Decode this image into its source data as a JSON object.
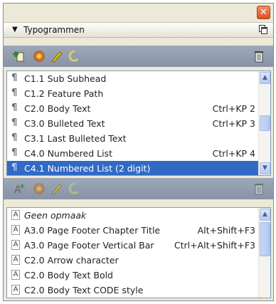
{
  "panel": {
    "title": "Typogrammen",
    "close_glyph": "✕"
  },
  "paragraph_styles": {
    "toolbar_icons": [
      "new-style-icon",
      "load-styles-icon",
      "edit-style-icon",
      "clear-overrides-icon",
      "delete-style-icon"
    ],
    "items": [
      {
        "label": "C1.1 Sub Subhead",
        "shortcut": "",
        "selected": false
      },
      {
        "label": "C1.2 Feature Path",
        "shortcut": "",
        "selected": false
      },
      {
        "label": "C2.0 Body Text",
        "shortcut": "Ctrl+KP 2",
        "selected": false
      },
      {
        "label": "C3.0 Bulleted Text",
        "shortcut": "Ctrl+KP 3",
        "selected": false
      },
      {
        "label": "C3.1 Last Bulleted Text",
        "shortcut": "",
        "selected": false
      },
      {
        "label": "C4.0 Numbered List",
        "shortcut": "Ctrl+KP 4",
        "selected": false
      },
      {
        "label": "C4.1 Numbered List (2 digit)",
        "shortcut": "",
        "selected": true
      }
    ]
  },
  "character_styles": {
    "toolbar_icons": [
      "new-style-icon",
      "load-styles-icon",
      "edit-style-icon",
      "clear-overrides-icon",
      "delete-style-icon"
    ],
    "items": [
      {
        "label": "Geen opmaak",
        "shortcut": "",
        "italic": true
      },
      {
        "label": "A3.0 Page Footer Chapter Title",
        "shortcut": "Alt+Shift+F3"
      },
      {
        "label": "A3.0 Page Footer Vertical Bar",
        "shortcut": "Ctrl+Alt+Shift+F3"
      },
      {
        "label": "C2.0 Arrow character",
        "shortcut": ""
      },
      {
        "label": "C2.0 Body Text Bold",
        "shortcut": ""
      },
      {
        "label": "C2.0 Body Text CODE style",
        "shortcut": ""
      }
    ]
  },
  "colors": {
    "toolbar": "#8f9bae",
    "selection": "#316ac5",
    "close_button": "#d9531f"
  }
}
